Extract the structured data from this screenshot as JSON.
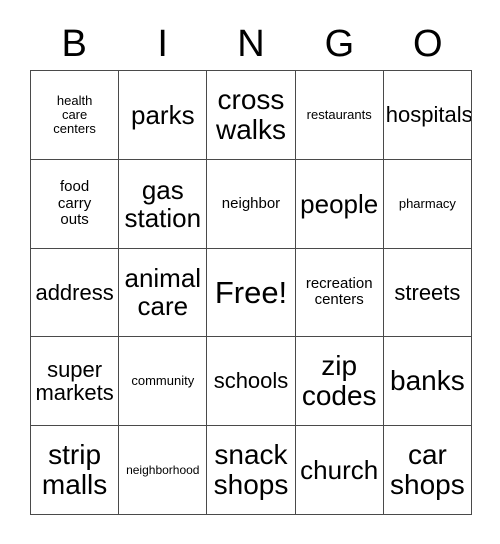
{
  "card": {
    "title_letters": [
      "B",
      "I",
      "N",
      "G",
      "O"
    ],
    "free_space_label": "Free!",
    "colors": {
      "background": "#ffffff",
      "text": "#000000",
      "grid_line": "#4a4a4a"
    },
    "rows": [
      [
        {
          "text": "health\ncare\ncenters",
          "size": "sm"
        },
        {
          "text": "parks",
          "size": "xl"
        },
        {
          "text": "cross\nwalks",
          "size": "xxl"
        },
        {
          "text": "restaurants",
          "size": "sm"
        },
        {
          "text": "hospitals",
          "size": "lg"
        }
      ],
      [
        {
          "text": "food\ncarry\nouts",
          "size": "md"
        },
        {
          "text": "gas\nstation",
          "size": "xl"
        },
        {
          "text": "neighbor",
          "size": "md"
        },
        {
          "text": "people",
          "size": "xl"
        },
        {
          "text": "pharmacy",
          "size": "sm"
        }
      ],
      [
        {
          "text": "address",
          "size": "lg"
        },
        {
          "text": "animal\ncare",
          "size": "xl"
        },
        {
          "text": "Free!",
          "size": "free"
        },
        {
          "text": "recreation\ncenters",
          "size": "md"
        },
        {
          "text": "streets",
          "size": "lg"
        }
      ],
      [
        {
          "text": "super\nmarkets",
          "size": "lg"
        },
        {
          "text": "community",
          "size": "sm"
        },
        {
          "text": "schools",
          "size": "lg"
        },
        {
          "text": "zip\ncodes",
          "size": "xxl"
        },
        {
          "text": "banks",
          "size": "xxl"
        }
      ],
      [
        {
          "text": "strip\nmalls",
          "size": "xxl"
        },
        {
          "text": "neighborhood",
          "size": "xs"
        },
        {
          "text": "snack\nshops",
          "size": "xxl"
        },
        {
          "text": "church",
          "size": "xl"
        },
        {
          "text": "car\nshops",
          "size": "xxl"
        }
      ]
    ]
  },
  "chart_data": {
    "type": "table",
    "title": "BINGO",
    "columns": [
      "B",
      "I",
      "N",
      "G",
      "O"
    ],
    "values": [
      [
        "health care centers",
        "parks",
        "cross walks",
        "restaurants",
        "hospitals"
      ],
      [
        "food carry outs",
        "gas station",
        "neighbor",
        "people",
        "pharmacy"
      ],
      [
        "address",
        "animal care",
        "Free!",
        "recreation centers",
        "streets"
      ],
      [
        "super markets",
        "community",
        "schools",
        "zip codes",
        "banks"
      ],
      [
        "strip malls",
        "neighborhood",
        "snack shops",
        "church",
        "car shops"
      ]
    ],
    "free_space": {
      "row": 2,
      "column": 2,
      "label": "Free!"
    },
    "grid": true,
    "legend": "none"
  }
}
